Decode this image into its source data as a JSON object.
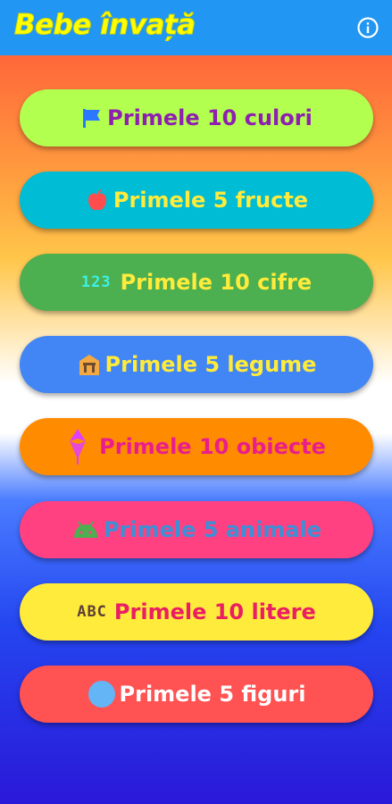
{
  "app": {
    "title": "Bebe învață",
    "info_icon": "info-icon"
  },
  "menu": [
    {
      "label": "Primele 10 culori",
      "icon": "flag-icon",
      "bg": "#b3ff4f",
      "fg": "#8e1fb0",
      "icon_color": "#2b78ff"
    },
    {
      "label": "Primele 5 fructe",
      "icon": "apple-icon",
      "bg": "#00bcd4",
      "fg": "#ffeb3b",
      "icon_color": "#ff4d4d"
    },
    {
      "label": "Primele 10 cifre",
      "icon": "numbers-icon",
      "icon_text": "123",
      "bg": "#4caf50",
      "fg": "#ffeb3b",
      "icon_color": "#3ff0e8"
    },
    {
      "label": "Primele 5 legume",
      "icon": "store-icon",
      "bg": "#4285f4",
      "fg": "#ffeb3b",
      "icon_color": "#f4a940"
    },
    {
      "label": "Primele 10 obiecte",
      "icon": "umbrella-icon",
      "bg": "#ff8c00",
      "fg": "#e91e8c",
      "icon_color": "#e040fb"
    },
    {
      "label": "Primele 5 animale",
      "icon": "android-icon",
      "bg": "#ff4081",
      "fg": "#3d8fd6",
      "icon_color": "#4caf50"
    },
    {
      "label": "Primele 10 litere",
      "icon": "abc-icon",
      "icon_text": "ABC",
      "bg": "#ffeb3b",
      "fg": "#e91e63",
      "icon_color": "#5d4037"
    },
    {
      "label": "Primele 5 figuri",
      "icon": "circle-icon",
      "bg": "#ff5252",
      "fg": "#ffffff",
      "icon_color": "#64b5f6"
    }
  ]
}
